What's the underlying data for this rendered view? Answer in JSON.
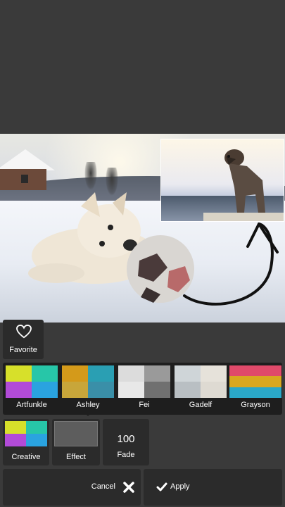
{
  "toolbar": {
    "favorite_label": "Favorite",
    "favorite_icon": "heart-icon"
  },
  "filters": [
    {
      "name": "Artfunkle",
      "colors": [
        "#d7e02a",
        "#27c6a8",
        "#b24bd8",
        "#2aa3e0"
      ]
    },
    {
      "name": "Ashley",
      "colors": [
        "#d49a1a",
        "#2a9fb3",
        "#c8a63a",
        "#3a8fa8"
      ]
    },
    {
      "name": "Fei",
      "colors": [
        "#dcdcdc",
        "#9a9a9a",
        "#e8e8e8",
        "#707070"
      ]
    },
    {
      "name": "Gadelf",
      "colors": [
        "#cfd5d8",
        "#e6e2da",
        "#b9bfc3",
        "#dedad2"
      ]
    },
    {
      "name": "Grayson",
      "colors": [
        "#e04a6a",
        "#d8a820",
        "#2aa8c8",
        "#e04a6a"
      ]
    }
  ],
  "selected_filter": "Ashley",
  "options": {
    "creative_label": "Creative",
    "effect_label": "Effect",
    "fade_value": "100",
    "fade_label": "Fade"
  },
  "actions": {
    "cancel_label": "Cancel",
    "apply_label": "Apply"
  },
  "colors": {
    "background": "#3a3a3a",
    "tile": "#2b2b2b",
    "filter_strip": "#1e1e1e"
  }
}
